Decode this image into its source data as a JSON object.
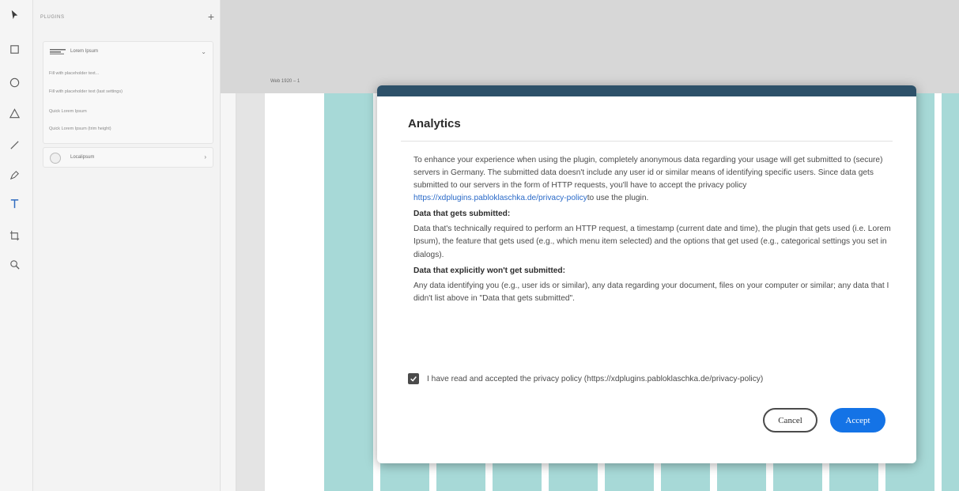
{
  "panel": {
    "title": "PLUGINS",
    "add_label": "+",
    "plugins": [
      {
        "name": "Lorem Ipsum",
        "expanded": true,
        "menu_items": [
          "Fill with placeholder text...",
          "Fill with placeholder text (last settings)",
          "Quick Lorem Ipsum",
          "Quick Lorem Ipsum (trim height)"
        ]
      },
      {
        "name": "Localipsum",
        "expanded": false
      }
    ]
  },
  "canvas": {
    "artboard_label": "Web 1920 – 1"
  },
  "modal": {
    "title": "Analytics",
    "intro_text": "To enhance your experience when using the plugin, completely anonymous data regarding your usage will get submitted to (secure) servers in Germany. The submitted data doesn't include any user id or similar means of identifying specific users. Since data gets submitted to our servers in the form of HTTP requests, you'll have to accept the privacy policy ",
    "privacy_link": "https://xdplugins.pabloklaschka.de/privacy-policy",
    "intro_suffix": "to use the plugin.",
    "submitted_heading": "Data that gets submitted:",
    "submitted_text": "Data that's technically required to perform an HTTP request, a timestamp (current date and time), the plugin that gets used (i.e. Lorem Ipsum), the feature that gets used (e.g., which menu item selected) and the options that get used (e.g., categorical settings you set in dialogs).",
    "not_submitted_heading": "Data that explicitly won't get submitted:",
    "not_submitted_text": "Any data identifying you (e.g., user ids or similar), any data regarding your document, files on your computer or similar; any data that I didn't list above in \"Data that gets submitted\".",
    "checkbox_label": "I have read and accepted the privacy policy (https://xdplugins.pabloklaschka.de/privacy-policy)",
    "checkbox_checked": true,
    "cancel_label": "Cancel",
    "accept_label": "Accept"
  },
  "colors": {
    "modal_bar": "#2d5169",
    "accent": "#1473e6",
    "grid_column": "#a7d9d7",
    "link": "#2a6ac8"
  },
  "icons": [
    "select-arrow-icon",
    "rectangle-icon",
    "ellipse-icon",
    "polygon-icon",
    "line-icon",
    "pen-icon",
    "text-icon",
    "artboard-icon",
    "zoom-icon"
  ]
}
